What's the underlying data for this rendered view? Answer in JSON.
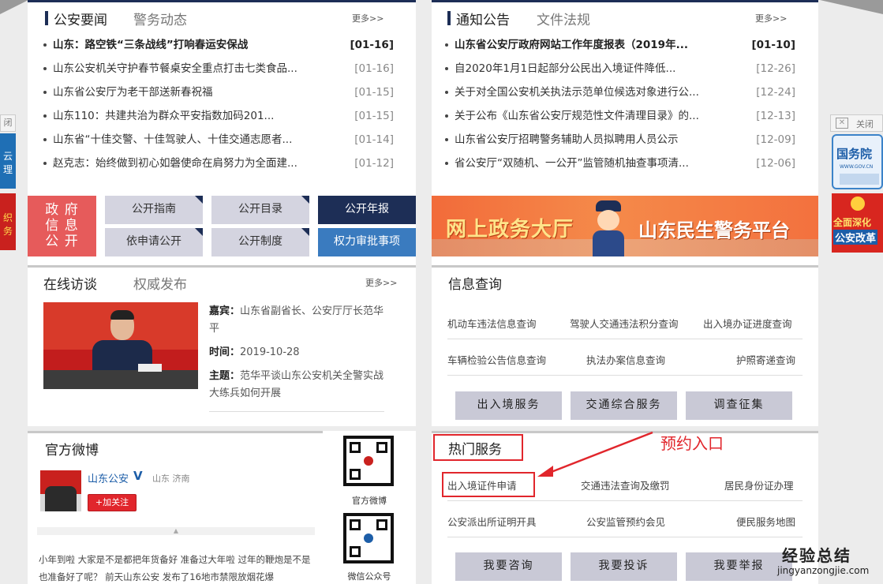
{
  "news_panel": {
    "tab_active": "公安要闻",
    "tab_inactive": "警务动态",
    "more": "更多>>",
    "items": [
      {
        "title": "山东：路空铁“三条战线”打响春运安保战",
        "date": "[01-16]"
      },
      {
        "title": "山东公安机关守护春节餐桌安全重点打击七类食品...",
        "date": "[01-16]"
      },
      {
        "title": "山东省公安厅为老干部送新春祝福",
        "date": "[01-15]"
      },
      {
        "title": "山东110：共建共治为群众平安指数加码201...",
        "date": "[01-15]"
      },
      {
        "title": "山东省“十佳交警、十佳驾驶人、十佳交通志愿者...",
        "date": "[01-14]"
      },
      {
        "title": "赵克志：始终做到初心如磐使命在肩努力为全面建...",
        "date": "[01-12]"
      }
    ]
  },
  "notice_panel": {
    "tab_active": "通知公告",
    "tab_inactive": "文件法规",
    "more": "更多>>",
    "items": [
      {
        "title": "山东省公安厅政府网站工作年度报表（2019年...",
        "date": "[01-10]"
      },
      {
        "title": "自2020年1月1日起部分公民出入境证件降低...",
        "date": "[12-26]"
      },
      {
        "title": "关于对全国公安机关执法示范单位候选对象进行公...",
        "date": "[12-24]"
      },
      {
        "title": "关于公布《山东省公安厅规范性文件清理目录》的...",
        "date": "[12-13]"
      },
      {
        "title": "山东省公安厅招聘警务辅助人员拟聘用人员公示",
        "date": "[12-09]"
      },
      {
        "title": "省公安厅“双随机、一公开”监管随机抽查事项清...",
        "date": "[12-06]"
      }
    ]
  },
  "gov_info": {
    "label_lines": [
      "政 府",
      "信 息",
      "公 开"
    ],
    "buttons": [
      "公开指南",
      "公开目录",
      "公开年报",
      "依申请公开",
      "公开制度",
      "权力审批事项"
    ]
  },
  "banner": {
    "left_text": "网上政务大厅",
    "right_text": "山东民生警务平台"
  },
  "interview_panel": {
    "tab_active": "在线访谈",
    "tab_inactive": "权威发布",
    "more": "更多>>",
    "guest_label": "嘉宾：",
    "guest_value": "山东省副省长、公安厅厅长范华平",
    "time_label": "时间：",
    "time_value": "2019-10-28",
    "topic_label": "主题：",
    "topic_value": "范华平谈山东公安机关全警实战大练兵如何开展"
  },
  "query_panel": {
    "title": "信息查询",
    "links": [
      "机动车违法信息查询",
      "驾驶人交通违法积分查询",
      "出入境办证进度查询",
      "车辆检验公告信息查询",
      "执法办案信息查询",
      "护照寄递查询"
    ],
    "services": [
      "出入境服务",
      "交通综合服务",
      "调查征集"
    ]
  },
  "weibo_panel": {
    "title": "官方微博",
    "account": "山东公安",
    "verified": "V",
    "location": "山东 济南",
    "follow": "+加关注",
    "post": "小年到啦 大家是不是都把年货备好 准备过大年啦 过年的鞭炮是不是也准备好了呢？ 前天山东公安 发布了16地市禁限放烟花爆",
    "qr1_label": "官方微博",
    "qr2_label": "微信公众号"
  },
  "hot_panel": {
    "title": "热门服务",
    "annotation": "预约入口",
    "links": [
      "出入境证件申请",
      "交通违法查询及缴罚",
      "居民身份证办理",
      "公安派出所证明开具",
      "公安监管预约会见",
      "便民服务地图"
    ],
    "buttons": [
      "我要咨询",
      "我要投诉",
      "我要举报"
    ]
  },
  "side_left": {
    "close": "闭",
    "text1": "云",
    "text2": "理",
    "text3": "织",
    "text4": "务"
  },
  "side_right": {
    "close": "关闭",
    "ad1_text": "国务院",
    "ad1_sub": "WWW.GOV.CN",
    "ad2_text1": "全面深化",
    "ad2_text2": "公安改革"
  },
  "watermark": {
    "main": "经验总结",
    "url": "jingyanzongjie.com"
  },
  "colors": {
    "navy": "#1d2e56",
    "red": "#e1262c",
    "blue": "#3a7bbf"
  }
}
